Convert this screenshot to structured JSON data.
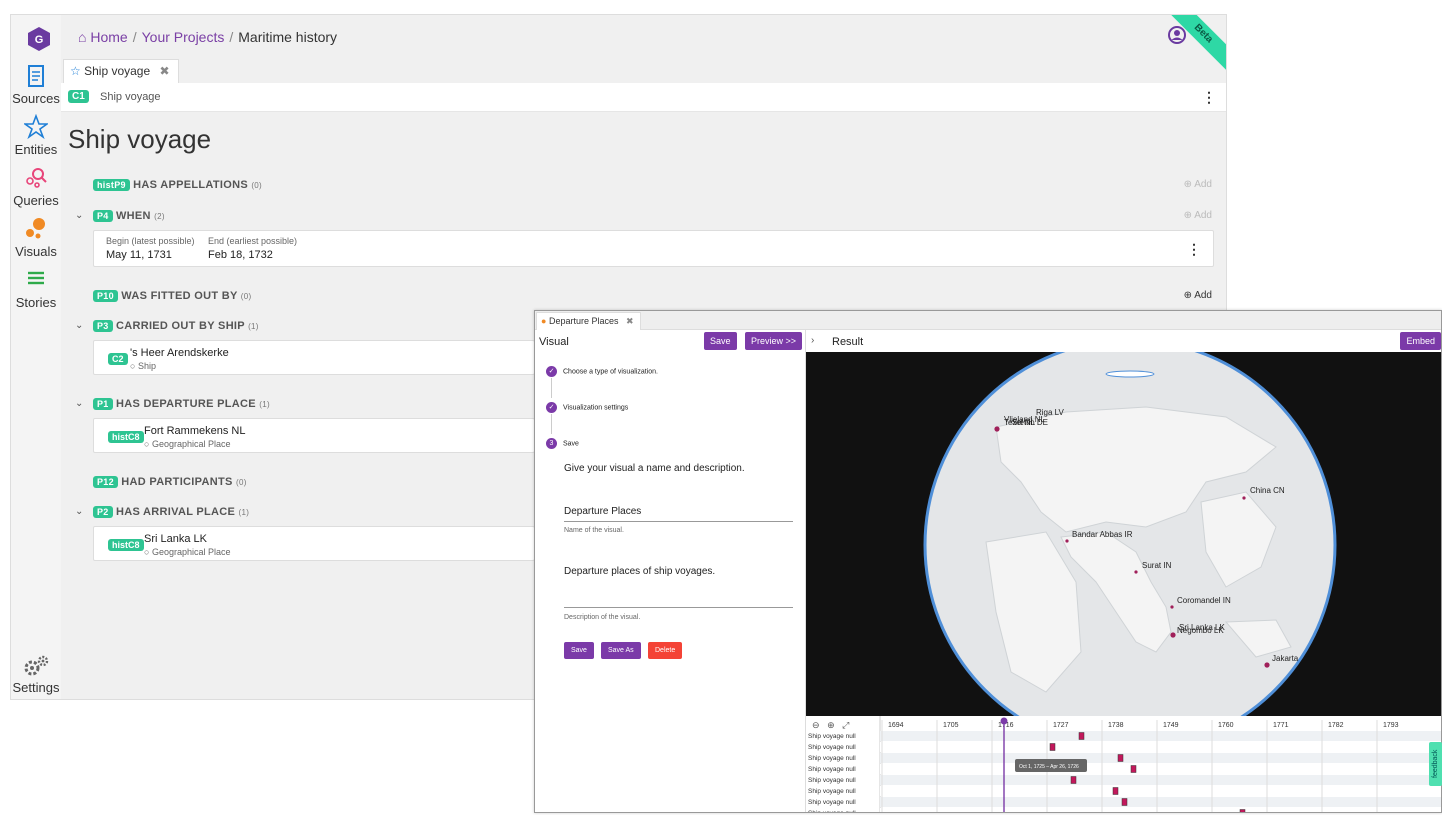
{
  "sidebar": {
    "logo_letter": "G",
    "items": [
      {
        "label": "Sources"
      },
      {
        "label": "Entities"
      },
      {
        "label": "Queries"
      },
      {
        "label": "Visuals"
      },
      {
        "label": "Stories"
      }
    ],
    "settings_label": "Settings"
  },
  "breadcrumb": {
    "home": "Home",
    "sep": "/",
    "projects": "Your Projects",
    "current": "Maritime history"
  },
  "beta_label": "Beta",
  "tab": {
    "label": "Ship voyage",
    "close": "✖"
  },
  "subbar": {
    "badge": "C1",
    "label": "Ship voyage"
  },
  "page": {
    "title": "Ship voyage",
    "add_label": "Add",
    "properties": [
      {
        "badge": "histP9",
        "label": "HAS APPELLATIONS",
        "count": "(0)"
      },
      {
        "badge": "P4",
        "label": "WHEN",
        "count": "(2)"
      },
      {
        "badge": "P10",
        "label": "WAS FITTED OUT BY",
        "count": "(0)"
      },
      {
        "badge": "P3",
        "label": "CARRIED OUT BY SHIP",
        "count": "(1)"
      },
      {
        "badge": "P1",
        "label": "HAS DEPARTURE PLACE",
        "count": "(1)"
      },
      {
        "badge": "P12",
        "label": "HAD PARTICIPANTS",
        "count": "(0)"
      },
      {
        "badge": "P2",
        "label": "HAS ARRIVAL PLACE",
        "count": "(1)"
      }
    ],
    "when": {
      "begin_label": "Begin (latest possible)",
      "begin_value": "May 11, 1731",
      "end_label": "End (earliest possible)",
      "end_value": "Feb 18, 1732"
    },
    "ship": {
      "badge": "C2",
      "name": "'s Heer Arendskerke",
      "type": "Ship"
    },
    "departure": {
      "badge": "histC8",
      "name": "Fort Rammekens NL",
      "type": "Geographical Place"
    },
    "arrival": {
      "badge": "histC8",
      "name": "Sri Lanka LK",
      "type": "Geographical Place"
    }
  },
  "visual_panel": {
    "tab_label": "Departure Places",
    "tab_close": "✖",
    "left_title": "Visual",
    "save_btn": "Save",
    "preview_btn": "Preview >>",
    "steps": [
      {
        "num": "1",
        "label": "Choose a type of visualization."
      },
      {
        "num": "2",
        "label": "Visualization settings"
      },
      {
        "num": "3",
        "label": "Save"
      }
    ],
    "prompt": "Give your visual a name and description.",
    "name_value": "Departure Places",
    "name_help": "Name of the visual.",
    "desc_value": "Departure places of ship voyages.",
    "desc_help": "Description of the visual.",
    "buttons": {
      "save": "Save",
      "save_as": "Save As",
      "delete": "Delete"
    },
    "right_title": "Result",
    "embed_btn": "Embed",
    "map_labels": [
      {
        "text": "Riga LV"
      },
      {
        "text": "Vlieland NL"
      },
      {
        "text": "Texel NL"
      },
      {
        "text": "Stettin DE"
      },
      {
        "text": "China CN"
      },
      {
        "text": "Bandar Abbas IR"
      },
      {
        "text": "Surat IN"
      },
      {
        "text": "Coromandel IN"
      },
      {
        "text": "Sri Lanka LK"
      },
      {
        "text": "Negombo LK"
      },
      {
        "text": "Jakarta"
      }
    ],
    "timeline": {
      "years": [
        "1694",
        "1705",
        "1716",
        "1727",
        "1738",
        "1749",
        "1760",
        "1771",
        "1782",
        "1793"
      ],
      "row_label": "Ship voyage null",
      "tooltip": "Oct 1, 1725 – Apr 26, 1726"
    }
  },
  "feedback_label": "feedback",
  "colors": {
    "accent": "#7b3aa8",
    "badge": "#2ec492",
    "danger": "#f44336",
    "beta": "#2ed8a5"
  }
}
